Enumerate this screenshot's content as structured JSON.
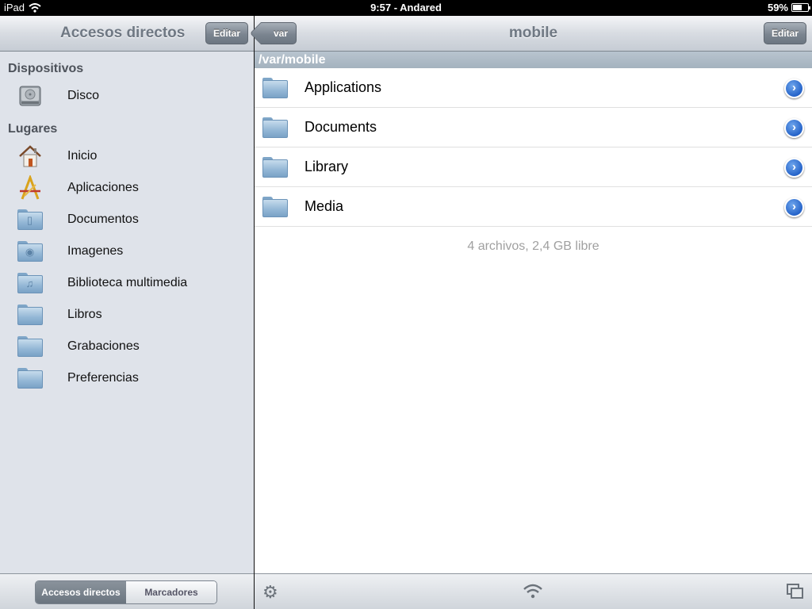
{
  "status_bar": {
    "carrier": "iPad",
    "time": "9:57 - Andared",
    "battery": "59%",
    "battery_level": 0.59
  },
  "left": {
    "title": "Accesos directos",
    "edit_label": "Editar",
    "sections": [
      {
        "title": "Dispositivos",
        "items": [
          {
            "label": "Disco",
            "icon": "disk-icon"
          }
        ]
      },
      {
        "title": "Lugares",
        "items": [
          {
            "label": "Inicio",
            "icon": "home-icon"
          },
          {
            "label": "Aplicaciones",
            "icon": "applications-icon"
          },
          {
            "label": "Documentos",
            "icon": "documents-folder-icon"
          },
          {
            "label": "Imagenes",
            "icon": "pictures-folder-icon"
          },
          {
            "label": "Biblioteca multimedia",
            "icon": "music-folder-icon"
          },
          {
            "label": "Libros",
            "icon": "folder-icon"
          },
          {
            "label": "Grabaciones",
            "icon": "folder-icon"
          },
          {
            "label": "Preferencias",
            "icon": "folder-icon"
          }
        ]
      }
    ],
    "segments": [
      "Accesos directos",
      "Marcadores"
    ],
    "selected_segment": "Accesos directos"
  },
  "right": {
    "back_label": "var",
    "title": "mobile",
    "edit_label": "Editar",
    "path": "/var/mobile",
    "rows": [
      {
        "name": "Applications"
      },
      {
        "name": "Documents"
      },
      {
        "name": "Library"
      },
      {
        "name": "Media"
      }
    ],
    "footer": "4 archivos, 2,4 GB libre",
    "toolbar_icons": [
      "gear-icon",
      "wifi-icon",
      "windows-icon"
    ]
  }
}
